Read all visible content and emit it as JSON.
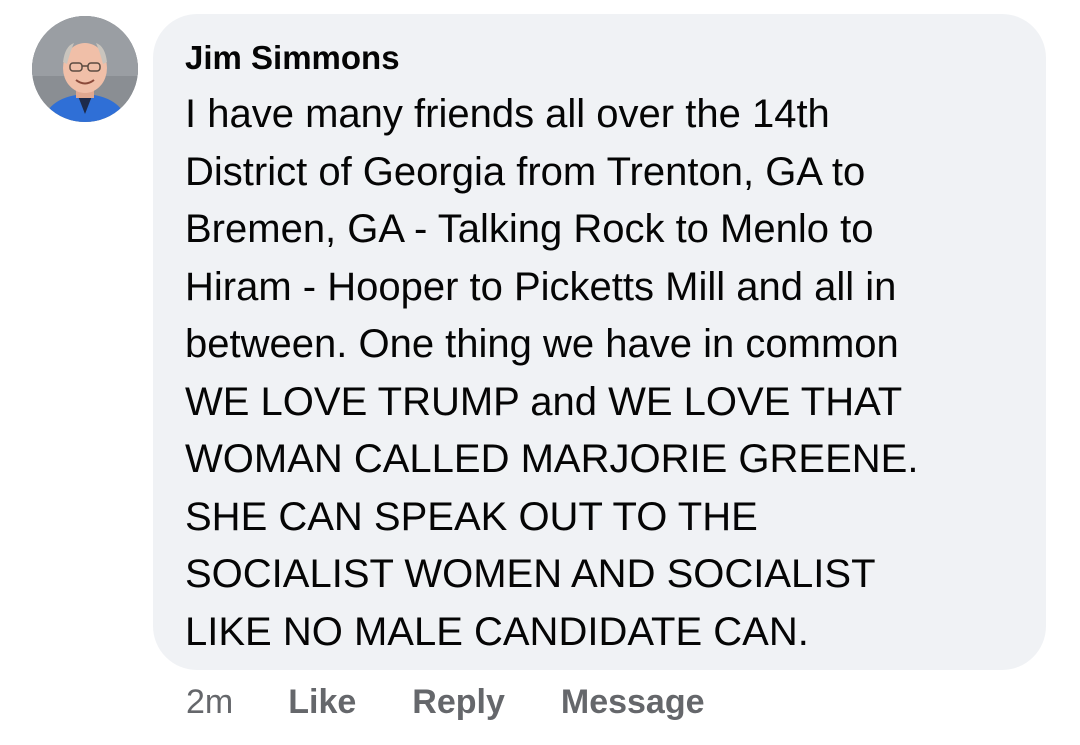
{
  "comment": {
    "author": "Jim Simmons",
    "text": "I have many friends all over the 14th\nDistrict of Georgia from Trenton, GA to\nBremen, GA - Talking Rock to Menlo to\nHiram - Hooper to Picketts Mill and all in\nbetween. One thing we have in common\nWE LOVE TRUMP and WE LOVE THAT\nWOMAN CALLED MARJORIE GREENE.\nSHE CAN SPEAK OUT TO THE\nSOCIALIST WOMEN AND SOCIALIST\nLIKE NO MALE CANDIDATE CAN.",
    "timestamp": "2m"
  },
  "actions": {
    "like_label": "Like",
    "reply_label": "Reply",
    "message_label": "Message"
  },
  "colors": {
    "bubble_background": "#f0f2f5",
    "primary_text": "#050505",
    "secondary_text": "#65676b"
  },
  "icons": {
    "avatar": "profile-photo"
  }
}
